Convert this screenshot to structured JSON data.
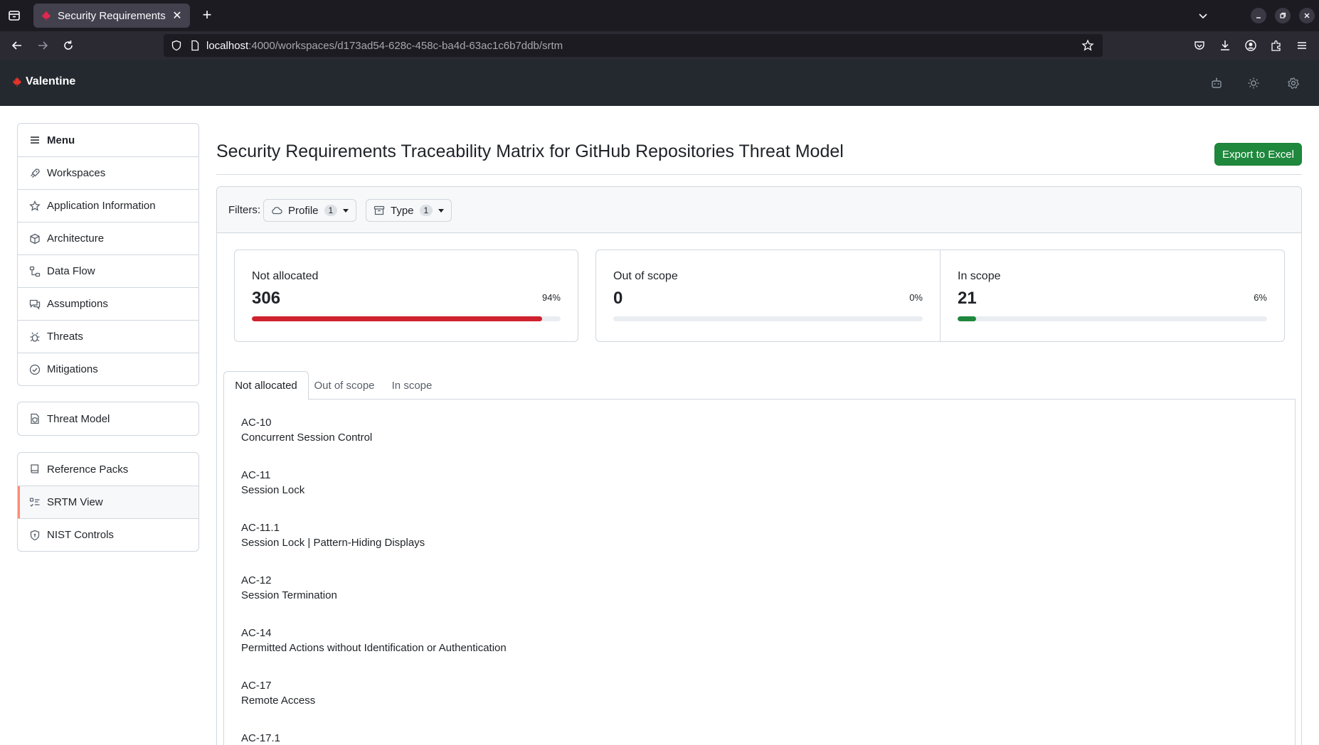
{
  "browser": {
    "tab_title": "Security Requirements T",
    "url_host": "localhost",
    "url_path": ":4000/workspaces/d173ad54-628c-458c-ba4d-63ac1c6b7ddb/srtm"
  },
  "app": {
    "brand": "Valentine"
  },
  "sidebar": {
    "menu_title": "Menu",
    "items": [
      {
        "label": "Workspaces",
        "icon": "rocket-icon"
      },
      {
        "label": "Application Information",
        "icon": "star-icon"
      },
      {
        "label": "Architecture",
        "icon": "cube-icon"
      },
      {
        "label": "Data Flow",
        "icon": "workflow-icon"
      },
      {
        "label": "Assumptions",
        "icon": "comment-icon"
      },
      {
        "label": "Threats",
        "icon": "bug-icon"
      },
      {
        "label": "Mitigations",
        "icon": "check-circle-icon"
      }
    ],
    "threat_model": "Threat Model",
    "reference": [
      {
        "label": "Reference Packs",
        "icon": "book-icon"
      },
      {
        "label": "SRTM View",
        "icon": "checklist-icon",
        "active": true
      },
      {
        "label": "NIST Controls",
        "icon": "shield-icon"
      }
    ]
  },
  "main": {
    "title": "Security Requirements Traceability Matrix for GitHub Repositories Threat Model",
    "export_label": "Export to Excel",
    "filters_label": "Filters:",
    "filters": [
      {
        "label": "Profile",
        "count": "1",
        "icon": "cloud-icon"
      },
      {
        "label": "Type",
        "count": "1",
        "icon": "archive-icon"
      }
    ]
  },
  "stats": [
    {
      "label": "Not allocated",
      "value": "306",
      "percent": "94%",
      "fill": 0.94,
      "color": "#cf222e"
    },
    {
      "label": "Out of scope",
      "value": "0",
      "percent": "0%",
      "fill": 0.0,
      "color": "#1f883d"
    },
    {
      "label": "In scope",
      "value": "21",
      "percent": "6%",
      "fill": 0.06,
      "color": "#1f883d"
    }
  ],
  "tabs": [
    "Not allocated",
    "Out of scope",
    "In scope"
  ],
  "requirements": [
    {
      "id": "AC-10",
      "name": "Concurrent Session Control"
    },
    {
      "id": "AC-11",
      "name": "Session Lock"
    },
    {
      "id": "AC-11.1",
      "name": "Session Lock | Pattern-Hiding Displays"
    },
    {
      "id": "AC-12",
      "name": "Session Termination"
    },
    {
      "id": "AC-14",
      "name": "Permitted Actions without Identification or Authentication"
    },
    {
      "id": "AC-17",
      "name": "Remote Access"
    },
    {
      "id": "AC-17.1",
      "name": ""
    }
  ]
}
